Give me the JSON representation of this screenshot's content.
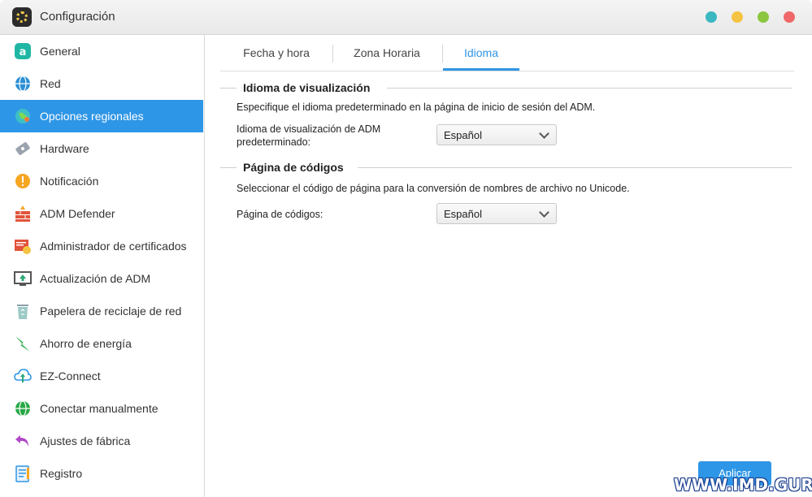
{
  "window": {
    "title": "Configuración",
    "controls": [
      {
        "name": "teal",
        "color": "#3bb8c2"
      },
      {
        "name": "yellow",
        "color": "#f5c342"
      },
      {
        "name": "green",
        "color": "#8cc63f"
      },
      {
        "name": "red",
        "color": "#f0686a"
      }
    ]
  },
  "sidebar": {
    "items": [
      {
        "label": "General",
        "icon": "general-icon",
        "active": false
      },
      {
        "label": "Red",
        "icon": "globe-icon",
        "active": false
      },
      {
        "label": "Opciones regionales",
        "icon": "regional-icon",
        "active": true
      },
      {
        "label": "Hardware",
        "icon": "hardware-icon",
        "active": false
      },
      {
        "label": "Notificación",
        "icon": "notification-icon",
        "active": false
      },
      {
        "label": "ADM Defender",
        "icon": "firewall-icon",
        "active": false
      },
      {
        "label": "Administrador de certificados",
        "icon": "certificate-icon",
        "active": false
      },
      {
        "label": "Actualización de ADM",
        "icon": "update-icon",
        "active": false
      },
      {
        "label": "Papelera de reciclaje de red",
        "icon": "recycle-bin-icon",
        "active": false
      },
      {
        "label": "Ahorro de energía",
        "icon": "energy-icon",
        "active": false
      },
      {
        "label": "EZ-Connect",
        "icon": "cloud-icon",
        "active": false
      },
      {
        "label": "Conectar manualmente",
        "icon": "connect-icon",
        "active": false
      },
      {
        "label": "Ajustes de fábrica",
        "icon": "reset-icon",
        "active": false
      },
      {
        "label": "Registro",
        "icon": "log-icon",
        "active": false
      }
    ]
  },
  "tabs": [
    {
      "label": "Fecha y hora",
      "active": false
    },
    {
      "label": "Zona Horaria",
      "active": false
    },
    {
      "label": "Idioma",
      "active": true
    }
  ],
  "display_language": {
    "title": "Idioma de visualización",
    "description": "Especifique el idioma predeterminado en la página de inicio de sesión del ADM.",
    "field_label_line1": "Idioma de visualización de ADM",
    "field_label_line2": "predeterminado:",
    "value": "Español"
  },
  "code_page": {
    "title": "Página de códigos",
    "description": "Seleccionar el código de página para la conversión de nombres de archivo no Unicode.",
    "field_label": "Página de códigos:",
    "value": "Español"
  },
  "apply_label": "Aplicar",
  "watermark": "WWW.IMD.GURU",
  "accent_color": "#2e96e6"
}
